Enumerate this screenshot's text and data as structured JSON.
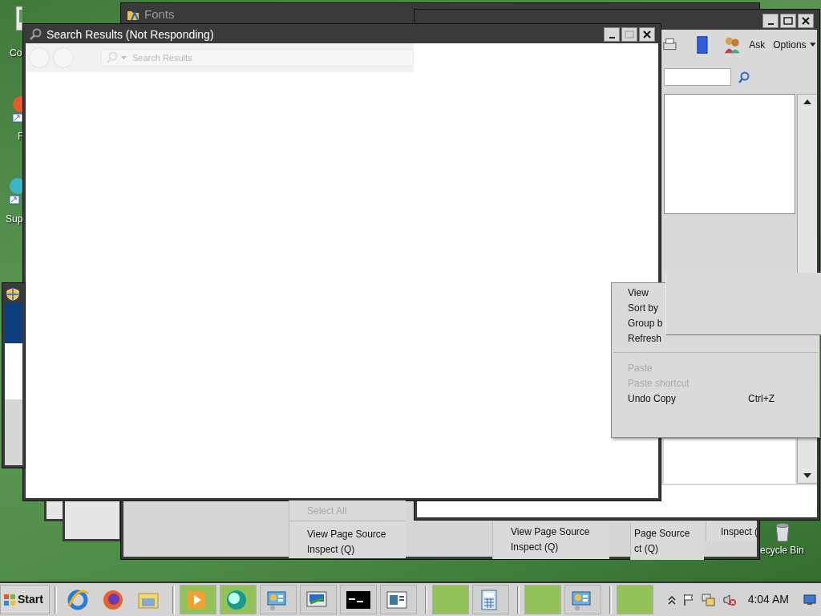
{
  "desktop_icons": [
    {
      "label": "Co"
    },
    {
      "label": "F"
    },
    {
      "label": "Sup"
    },
    {
      "label": "ecycle Bin"
    }
  ],
  "windows": [
    {
      "kind": "fonts",
      "title": "Fonts"
    },
    {
      "kind": "help",
      "toolbar": [
        {
          "label": "Ask"
        },
        {
          "label": "Options"
        }
      ]
    },
    {
      "kind": "search",
      "title": "Search Results (Not Responding)",
      "address": "Search Results"
    }
  ],
  "context_menu": {
    "items": [
      {
        "kind": "item",
        "label": "View",
        "disabled": false
      },
      {
        "kind": "item",
        "label": "Sort by",
        "disabled": false
      },
      {
        "kind": "item",
        "label": "Group b",
        "disabled": false
      },
      {
        "kind": "item",
        "label": "Refresh",
        "disabled": false
      },
      {
        "kind": "separator"
      },
      {
        "kind": "item",
        "label": "Paste",
        "disabled": true
      },
      {
        "kind": "item",
        "label": "Paste shortcut",
        "disabled": true
      },
      {
        "kind": "item",
        "label": "Undo Copy",
        "shortcut": "Ctrl+Z",
        "disabled": false
      }
    ]
  },
  "menu_fragments": [
    {
      "items": [
        {
          "kind": "item",
          "label": "Select All",
          "disabled": true
        },
        {
          "kind": "separator"
        },
        {
          "kind": "item",
          "label": "View Page Source",
          "disabled": false
        },
        {
          "kind": "item",
          "label": "Inspect (Q)",
          "disabled": false
        }
      ]
    },
    {
      "items": [
        {
          "kind": "item",
          "label": "View Page Source",
          "disabled": false
        },
        {
          "kind": "item",
          "label": "Inspect (Q)",
          "disabled": false
        }
      ]
    },
    {
      "items": [
        {
          "kind": "item",
          "label": "Page Source",
          "disabled": false
        },
        {
          "kind": "item",
          "label": "ct (Q)",
          "disabled": false
        }
      ]
    },
    {
      "items": [
        {
          "kind": "item",
          "label": "Inspect (",
          "disabled": false
        }
      ]
    }
  ],
  "taskbar": {
    "start": "Start",
    "clock": "4:04 AM",
    "task_buttons": [
      {
        "flashing": true
      },
      {
        "flashing": true
      },
      {
        "flashing": false
      },
      {
        "flashing": false
      },
      {
        "flashing": false
      },
      {
        "flashing": false
      },
      {
        "flashing": true
      },
      {
        "flashing": false
      },
      {
        "flashing": true
      },
      {
        "flashing": false
      },
      {
        "flashing": true
      }
    ]
  }
}
